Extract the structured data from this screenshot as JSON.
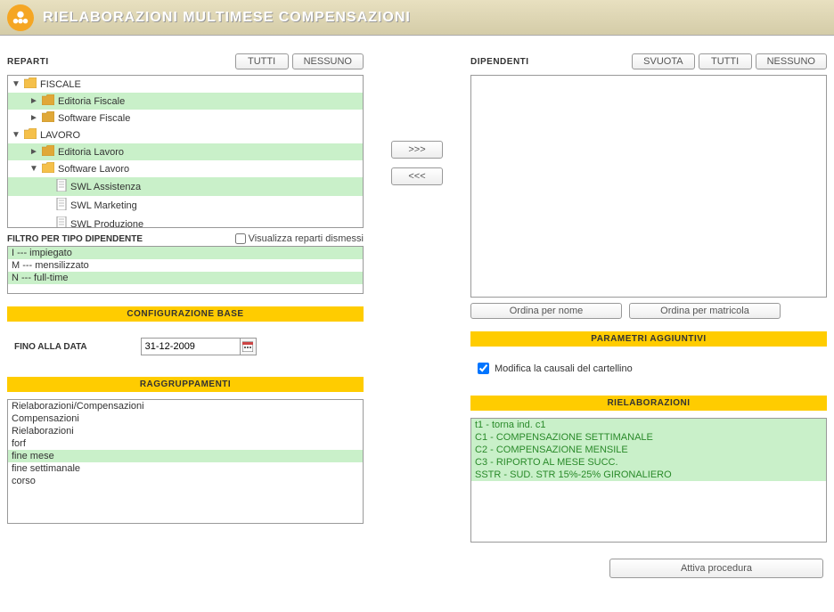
{
  "header": {
    "title": "RIELABORAZIONI MULTIMESE COMPENSAZIONI"
  },
  "reparti": {
    "label": "REPARTI",
    "btn_all": "TUTTI",
    "btn_none": "NESSUNO",
    "tree": [
      {
        "level": 0,
        "arrow": "▼",
        "icon": "folder-open",
        "label": "FISCALE",
        "sel": false
      },
      {
        "level": 1,
        "arrow": "►",
        "icon": "folder",
        "label": "Editoria Fiscale",
        "sel": true
      },
      {
        "level": 1,
        "arrow": "►",
        "icon": "folder",
        "label": "Software Fiscale",
        "sel": false
      },
      {
        "level": 0,
        "arrow": "▼",
        "icon": "folder-open",
        "label": "LAVORO",
        "sel": false
      },
      {
        "level": 1,
        "arrow": "►",
        "icon": "folder",
        "label": "Editoria Lavoro",
        "sel": true
      },
      {
        "level": 1,
        "arrow": "▼",
        "icon": "folder-open",
        "label": "Software Lavoro",
        "sel": false
      },
      {
        "level": 2,
        "arrow": "",
        "icon": "doc",
        "label": "SWL Assistenza",
        "sel": true
      },
      {
        "level": 2,
        "arrow": "",
        "icon": "doc",
        "label": "SWL Marketing",
        "sel": false
      },
      {
        "level": 2,
        "arrow": "",
        "icon": "doc",
        "label": "SWL Produzione",
        "sel": false
      }
    ],
    "show_dismissed": "Visualizza reparti dismessi"
  },
  "filtro": {
    "label": "FILTRO PER TIPO DIPENDENTE",
    "items": [
      {
        "label": "I --- impiegato",
        "sel": true
      },
      {
        "label": "M --- mensilizzato",
        "sel": false
      },
      {
        "label": "N --- full-time",
        "sel": true
      }
    ]
  },
  "config": {
    "bar": "CONFIGURAZIONE BASE",
    "label": "FINO ALLA DATA",
    "date": "31-12-2009"
  },
  "ragg": {
    "bar": "RAGGRUPPAMENTI",
    "items": [
      {
        "label": "Rielaborazioni/Compensazioni",
        "sel": false
      },
      {
        "label": "Compensazioni",
        "sel": false
      },
      {
        "label": "Rielaborazioni",
        "sel": false
      },
      {
        "label": "forf",
        "sel": false
      },
      {
        "label": "fine mese",
        "sel": true
      },
      {
        "label": "fine settimanale",
        "sel": false
      },
      {
        "label": "corso",
        "sel": false
      }
    ]
  },
  "dipendenti": {
    "label": "DIPENDENTI",
    "btn_empty": "SVUOTA",
    "btn_all": "TUTTI",
    "btn_none": "NESSUNO",
    "order_name": "Ordina per nome",
    "order_matr": "Ordina per matricola"
  },
  "transfer": {
    "fwd": ">>>",
    "back": "<<<"
  },
  "params": {
    "bar": "PARAMETRI AGGIUNTIVI",
    "modify": "Modifica la causali del cartellino"
  },
  "riel": {
    "bar": "RIELABORAZIONI",
    "items": [
      {
        "label": "t1 - torna ind. c1",
        "sel": true
      },
      {
        "label": "C1 - COMPENSAZIONE SETTIMANALE",
        "sel": true
      },
      {
        "label": "C2 - COMPENSAZIONE MENSILE",
        "sel": true
      },
      {
        "label": "C3 - RIPORTO AL MESE SUCC.",
        "sel": true
      },
      {
        "label": "SSTR - SUD. STR 15%-25% GIRONALIERO",
        "sel": true
      }
    ]
  },
  "footer": {
    "run": "Attiva procedura"
  }
}
